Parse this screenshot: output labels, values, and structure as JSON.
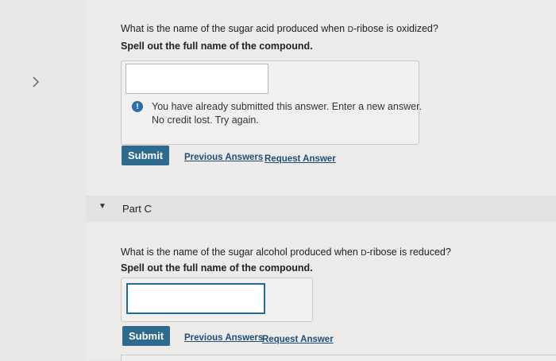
{
  "part_b": {
    "question_prefix": "What is the name of the sugar acid produced when ",
    "sc_letter": "D",
    "question_suffix": "-ribose is oxidized?",
    "instruction": "Spell out the full name of the compound.",
    "input_value": "",
    "feedback_line1": "You have already submitted this answer. Enter a new answer.",
    "feedback_line2": "No credit lost. Try again.",
    "submit_label": "Submit",
    "prev_label": "Previous Answers",
    "request_label": "Request Answer"
  },
  "part_c": {
    "header": "Part C",
    "question_prefix": "What is the name of the sugar alcohol produced when ",
    "sc_letter": "D",
    "question_suffix": "-ribose is reduced?",
    "instruction": "Spell out the full name of the compound.",
    "input_value": "",
    "submit_label": "Submit",
    "prev_label": "Previous Answers",
    "request_label": "Request Answer"
  },
  "icons": {
    "nav": "chevron-right-icon",
    "warning": "exclamation-icon",
    "collapse": "caret-down-icon"
  }
}
